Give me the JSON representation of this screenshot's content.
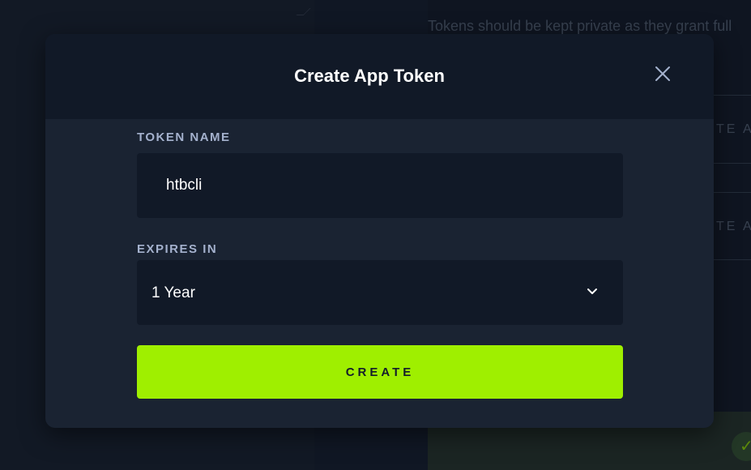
{
  "background": {
    "info_text": "Tokens should be kept private as they grant full",
    "labels": [
      "TE APP",
      "TE APP"
    ]
  },
  "modal": {
    "title": "Create App Token",
    "token_name": {
      "label": "TOKEN NAME",
      "value": "htbcli"
    },
    "expires_in": {
      "label": "EXPIRES IN",
      "selected": "1 Year"
    },
    "create_label": "CREATE"
  },
  "icons": {
    "close": "close-icon",
    "dropdown": "chevron-down-icon",
    "success": "check-icon"
  },
  "colors": {
    "accent": "#9fef00",
    "modal_bg": "#1a2332",
    "field_bg": "#111927",
    "label": "#a4b1cd"
  }
}
